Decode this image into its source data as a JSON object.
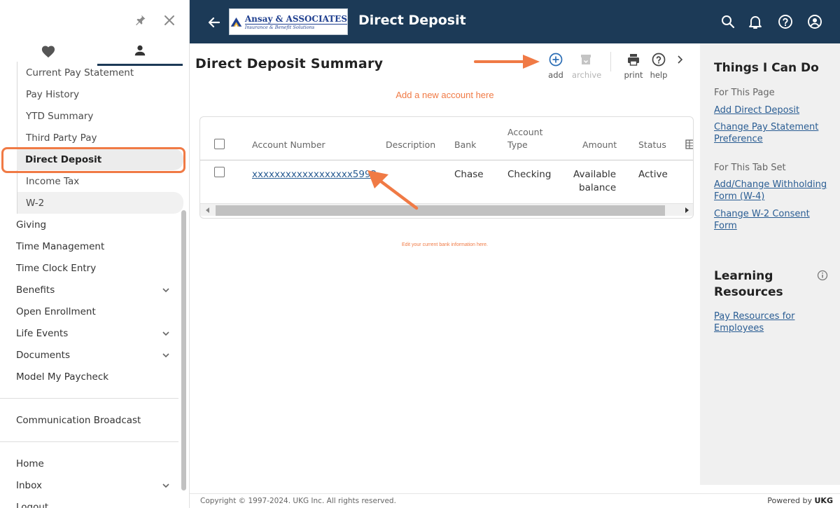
{
  "header": {
    "title": "Direct Deposit",
    "logo_name": "Ansay & ASSOCIATES",
    "logo_tagline": "Insurance & Benefit Solutions"
  },
  "sidebar": {
    "sub_items": [
      {
        "label": "Current Pay Statement"
      },
      {
        "label": "Pay History"
      },
      {
        "label": "YTD Summary"
      },
      {
        "label": "Third Party Pay"
      },
      {
        "label": "Direct Deposit",
        "active": true
      },
      {
        "label": "Income Tax"
      },
      {
        "label": "W-2"
      }
    ],
    "main_items": [
      {
        "label": "Giving"
      },
      {
        "label": "Time Management"
      },
      {
        "label": "Time Clock Entry"
      },
      {
        "label": "Benefits",
        "expandable": true
      },
      {
        "label": "Open Enrollment"
      },
      {
        "label": "Life Events",
        "expandable": true
      },
      {
        "label": "Documents",
        "expandable": true
      },
      {
        "label": "Model My Paycheck"
      }
    ],
    "bottom_items": [
      {
        "label": "Communication Broadcast"
      }
    ],
    "home_items": [
      {
        "label": "Home"
      },
      {
        "label": "Inbox",
        "expandable": true
      },
      {
        "label": "Logout"
      }
    ]
  },
  "main": {
    "page_title": "Direct Deposit Summary",
    "toolbar": {
      "add": "add",
      "archive": "archive",
      "print": "print",
      "help": "help"
    },
    "annotation_add": "Add a new account here",
    "annotation_edit": "Edit your current bank information here.",
    "grid": {
      "columns": {
        "account_number": "Account Number",
        "description": "Description",
        "bank": "Bank",
        "account_type_1": "Account",
        "account_type_2": "Type",
        "amount": "Amount",
        "status": "Status"
      },
      "rows": [
        {
          "account_number": "xxxxxxxxxxxxxxxxxx5992",
          "description": "",
          "bank": "Chase",
          "account_type": "Checking",
          "amount_1": "Available",
          "amount_2": "balance",
          "status": "Active"
        }
      ]
    }
  },
  "right_panel": {
    "title": "Things I Can Do",
    "section1_label": "For This Page",
    "section1_links": [
      "Add Direct Deposit",
      "Change Pay Statement Preference"
    ],
    "section2_label": "For This Tab Set",
    "section2_links": [
      "Add/Change Withholding Form (W-4)",
      "Change W-2 Consent Form"
    ],
    "learning_title": "Learning Resources",
    "learning_links": [
      "Pay Resources for Employees"
    ]
  },
  "footer": {
    "copyright": "Copyright © 1997-2024. UKG Inc. All rights reserved.",
    "powered_prefix": "Powered by",
    "powered_brand": "UKG"
  },
  "colors": {
    "header_bg": "#1c3a57",
    "accent_orange": "#f07a45",
    "link_blue": "#2a5d93",
    "add_icon_blue": "#2a6db5"
  }
}
